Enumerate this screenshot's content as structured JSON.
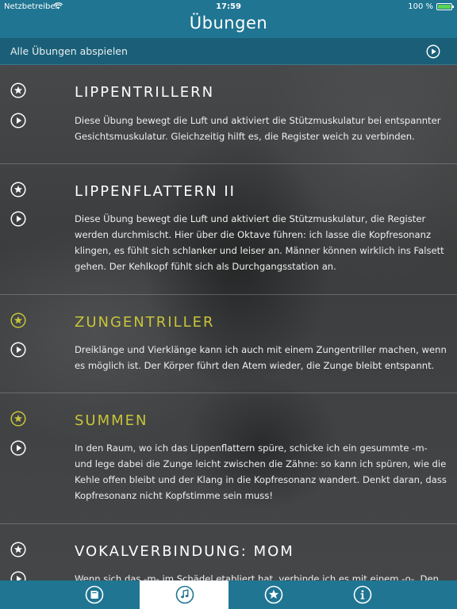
{
  "status": {
    "carrier": "Netzbetreiber",
    "time": "17:59",
    "battery": "100 %"
  },
  "header": {
    "title": "Übungen"
  },
  "play_all": {
    "label": "Alle Übungen abspielen"
  },
  "colors": {
    "header_blue": "#1f7592",
    "favorite_yellow": "#c8c43a"
  },
  "exercises": [
    {
      "title": "LIPPENTRILLERN",
      "favorite": false,
      "description": "Diese Übung bewegt die Luft und aktiviert die Stützmuskulatur bei entspannter Gesichtsmuskulatur. Gleichzeitig hilft es, die Register weich zu verbinden."
    },
    {
      "title": "LIPPENFLATTERN II",
      "favorite": false,
      "description": "Diese Übung bewegt die Luft und aktiviert die Stützmuskulatur, die Register werden durchmischt. Hier über die Oktave führen: ich lasse die Kopfresonanz klingen, es fühlt sich schlanker und leiser an. Männer können wirklich ins Falsett gehen. Der Kehlkopf fühlt sich als Durchgangsstation an."
    },
    {
      "title": "ZUNGENTRILLER",
      "favorite": true,
      "description": "Dreiklänge und Vierklänge kann ich auch mit einem Zungentriller machen, wenn es möglich ist. Der Körper führt den Atem wieder, die Zunge bleibt entspannt."
    },
    {
      "title": "SUMMEN",
      "favorite": true,
      "description": "In den Raum, wo ich das Lippenflattern spüre, schicke ich ein gesummte -m- und lege dabei die Zunge leicht zwischen die Zähne: so kann ich spüren, wie die Kehle offen bleibt und der Klang in die Kopfresonanz wandert. Denkt daran, dass Kopfresonanz nicht Kopfstimme sein muss!"
    },
    {
      "title": "VOKALVERBINDUNG: MOM",
      "favorite": false,
      "description": "Wenn sich das -m- im Schädel etabliert hat, verbinde ich es mit einem -o-. Den"
    }
  ],
  "tabs": [
    {
      "icon": "book-icon",
      "active": false
    },
    {
      "icon": "music-note-icon",
      "active": true
    },
    {
      "icon": "star-icon",
      "active": false
    },
    {
      "icon": "info-icon",
      "active": false
    }
  ]
}
